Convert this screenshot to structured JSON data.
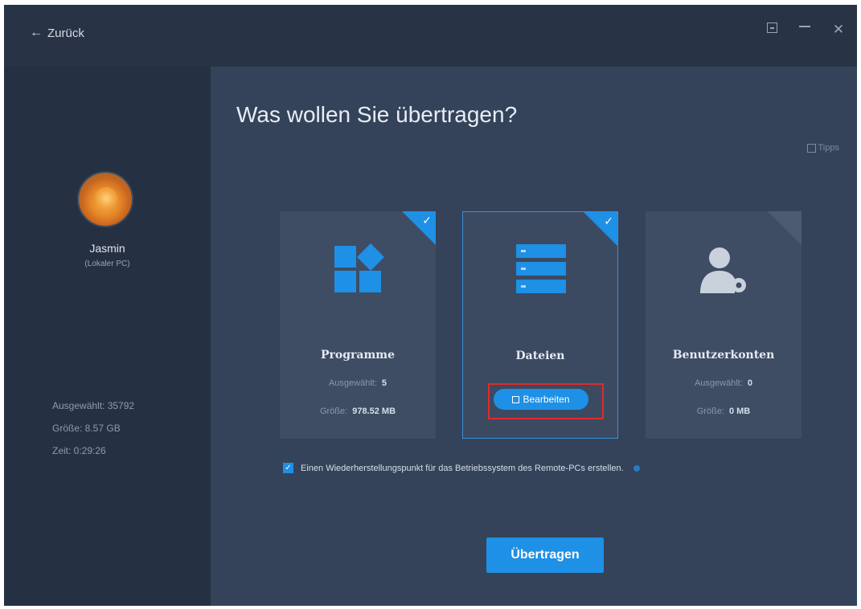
{
  "titlebar": {
    "back_label": "Zurück",
    "icons": [
      "restore-icon",
      "minimize-icon",
      "close-icon"
    ],
    "close_glyph": "✕"
  },
  "sidebar": {
    "user_name": "Jasmin",
    "user_sub": "(Lokaler PC)",
    "stats": {
      "selected": "Ausgewählt: 35792",
      "size": "Größe: 8.57 GB",
      "time": "Zeit: 0:29:26"
    }
  },
  "main": {
    "heading": "Was wollen Sie übertragen?",
    "tips_label": "Tipps",
    "cards": [
      {
        "title": "Programme",
        "selected_label": "Ausgewählt:",
        "selected_value": "5",
        "size_label": "Größe:",
        "size_value": "978.52 MB",
        "checked": true,
        "icon": "apps-icon"
      },
      {
        "title": "Dateien",
        "edit_label": "Bearbeiten",
        "checked": true,
        "icon": "files-icon"
      },
      {
        "title": "Benutzerkonten",
        "selected_label": "Ausgewählt:",
        "selected_value": "0",
        "size_label": "Größe:",
        "size_value": "0 MB",
        "checked": false,
        "icon": "user-settings-icon"
      }
    ],
    "restore_point_label": "Einen Wiederherstellungspunkt für das Betriebssystem des Remote-PCs erstellen.",
    "restore_point_checked": true,
    "transfer_label": "Übertragen"
  },
  "colors": {
    "accent": "#1e90e6",
    "background": "#34435a",
    "sidebar": "#253143",
    "highlight": "#e02b2b"
  }
}
